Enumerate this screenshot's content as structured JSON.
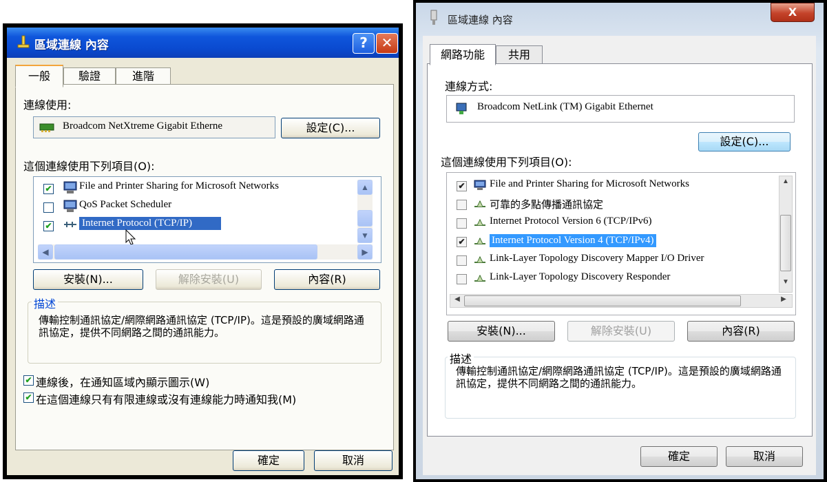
{
  "xp": {
    "title": "區域連線 內容",
    "help_btn": "?",
    "close_btn": "✕",
    "tabs": [
      "一般",
      "驗證",
      "進階"
    ],
    "connect_using_label": "連線使用:",
    "adapter_name": "Broadcom NetXtreme Gigabit Etherne",
    "configure_btn": "設定(C)...",
    "items_label": "這個連線使用下列項目(O):",
    "items": [
      {
        "checked": true,
        "label": "File and Printer Sharing for Microsoft Networks",
        "selected": false
      },
      {
        "checked": false,
        "label": "QoS Packet Scheduler",
        "selected": false
      },
      {
        "checked": true,
        "label": "Internet Protocol (TCP/IP)",
        "selected": true
      }
    ],
    "install_btn": "安裝(N)...",
    "uninstall_btn": "解除安裝(U)",
    "properties_btn": "內容(R)",
    "description_title": "描述",
    "description_text": "傳輸控制通訊協定/網際網路通訊協定 (TCP/IP)。這是預設的廣域網路通訊協定，提供不同網路之間的通訊能力。",
    "show_icon_label": "連線後，在通知區域內顯示圖示(W)",
    "notify_label": "在這個連線只有有限連線或沒有連線能力時通知我(M)",
    "ok_btn": "確定",
    "cancel_btn": "取消"
  },
  "vista": {
    "title": "區域連線 內容",
    "close_btn": "X",
    "tabs": [
      "網路功能",
      "共用"
    ],
    "connect_using_label": "連線方式:",
    "adapter_name": "Broadcom NetLink (TM) Gigabit Ethernet",
    "configure_btn": "設定(C)...",
    "items_label": "這個連線使用下列項目(O):",
    "items": [
      {
        "checked": true,
        "label": "File and Printer Sharing for Microsoft Networks",
        "selected": false
      },
      {
        "checked": false,
        "label": "可靠的多點傳播通訊協定",
        "selected": false
      },
      {
        "checked": false,
        "label": "Internet Protocol Version 6 (TCP/IPv6)",
        "selected": false
      },
      {
        "checked": true,
        "label": "Internet Protocol Version 4 (TCP/IPv4)",
        "selected": true
      },
      {
        "checked": false,
        "label": "Link-Layer Topology Discovery Mapper I/O Driver",
        "selected": false
      },
      {
        "checked": false,
        "label": "Link-Layer Topology Discovery Responder",
        "selected": false
      }
    ],
    "install_btn": "安裝(N)...",
    "uninstall_btn": "解除安裝(U)",
    "properties_btn": "內容(R)",
    "description_title": "描述",
    "description_text": "傳輸控制通訊協定/網際網路通訊協定 (TCP/IP)。這是預設的廣域網路通訊協定，提供不同網路之間的通訊能力。",
    "ok_btn": "確定",
    "cancel_btn": "取消"
  }
}
